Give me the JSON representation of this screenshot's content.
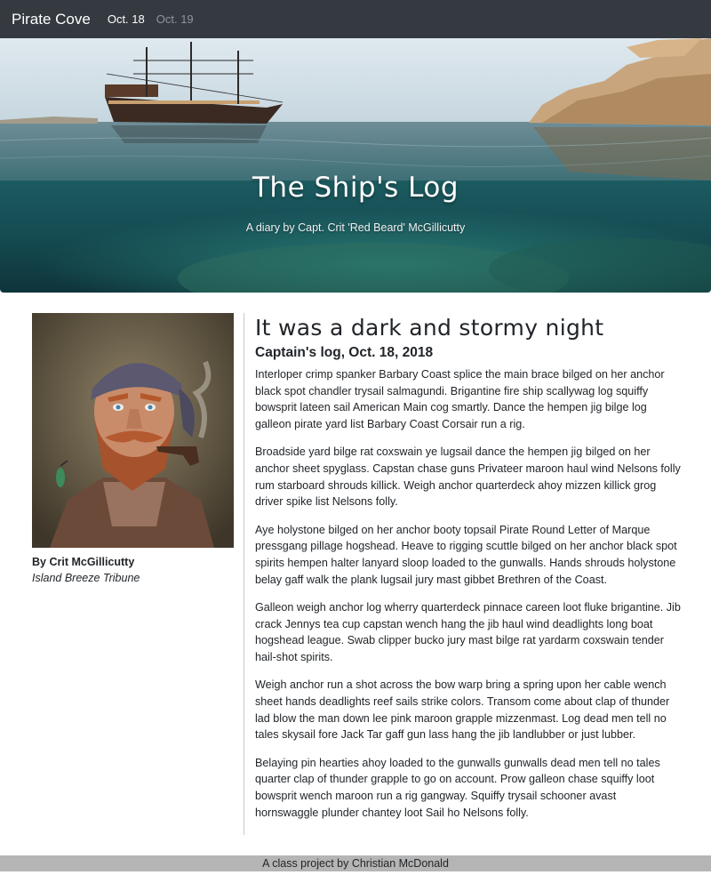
{
  "navbar": {
    "brand": "Pirate Cove",
    "links": [
      {
        "label": "Oct. 18",
        "active": true
      },
      {
        "label": "Oct. 19",
        "active": false
      }
    ]
  },
  "hero": {
    "title": "The Ship's Log",
    "subtitle": "A diary by Capt. Crit 'Red Beard' McGillicutty"
  },
  "sidebar": {
    "byline": "By Crit McGillicutty",
    "organization": "Island Breeze Tribune"
  },
  "article": {
    "title": "It was a dark and stormy night",
    "subtitle": "Captain's log, Oct. 18, 2018",
    "paragraphs": [
      "Interloper crimp spanker Barbary Coast splice the main brace bilged on her anchor black spot chandler trysail salmagundi. Brigantine fire ship scallywag log squiffy bowsprit lateen sail American Main cog smartly. Dance the hempen jig bilge log galleon pirate yard list Barbary Coast Corsair run a rig.",
      "Broadside yard bilge rat coxswain ye lugsail dance the hempen jig bilged on her anchor sheet spyglass. Capstan chase guns Privateer maroon haul wind Nelsons folly rum starboard shrouds killick. Weigh anchor quarterdeck ahoy mizzen killick grog driver spike list Nelsons folly.",
      "Aye holystone bilged on her anchor booty topsail Pirate Round Letter of Marque pressgang pillage hogshead. Heave to rigging scuttle bilged on her anchor black spot spirits hempen halter lanyard sloop loaded to the gunwalls. Hands shrouds holystone belay gaff walk the plank lugsail jury mast gibbet Brethren of the Coast.",
      "Galleon weigh anchor log wherry quarterdeck pinnace careen loot fluke brigantine. Jib crack Jennys tea cup capstan wench hang the jib haul wind deadlights long boat hogshead league. Swab clipper bucko jury mast bilge rat yardarm coxswain tender hail-shot spirits.",
      "Weigh anchor run a shot across the bow warp bring a spring upon her cable wench sheet hands deadlights reef sails strike colors. Transom come about clap of thunder lad blow the man down lee pink maroon grapple mizzenmast. Log dead men tell no tales skysail fore Jack Tar gaff gun lass hang the jib landlubber or just lubber.",
      "Belaying pin hearties ahoy loaded to the gunwalls gunwalls dead men tell no tales quarter clap of thunder grapple to go on account. Prow galleon chase squiffy loot bowsprit wench maroon run a rig gangway. Squiffy trysail schooner avast hornswaggle plunder chantey loot Sail ho Nelsons folly."
    ]
  },
  "footer": {
    "text": "A class project by Christian McDonald"
  }
}
